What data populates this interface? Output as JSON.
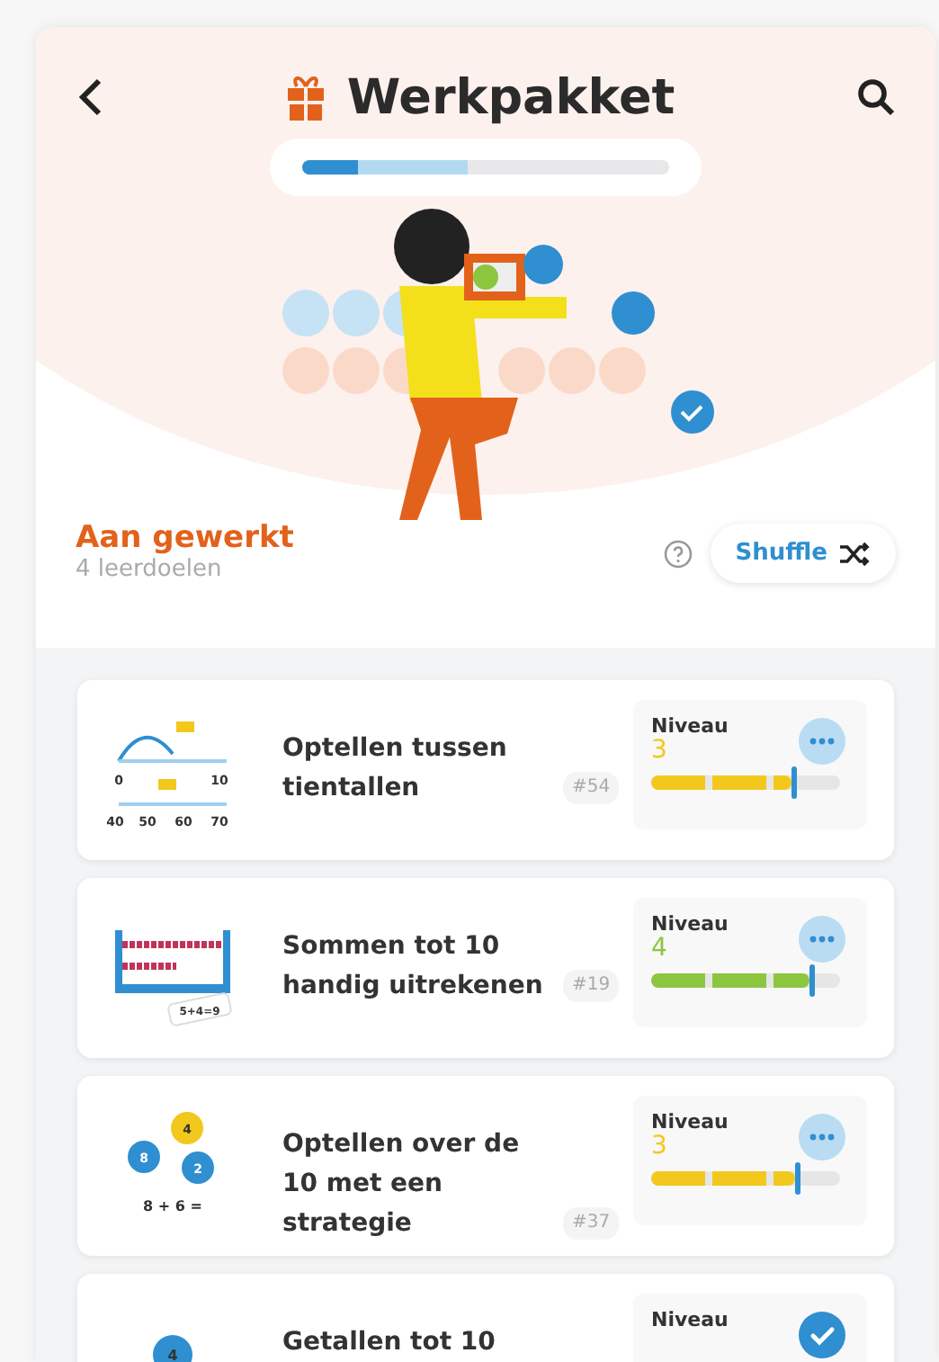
{
  "header": {
    "title": "Werkpakket",
    "progress": {
      "segments": [
        {
          "kind": "done",
          "level": 0.15
        },
        {
          "kind": "started",
          "level": 0.3
        }
      ]
    }
  },
  "section": {
    "title": "Aan gewerkt",
    "subtitle": "4 leerdoelen",
    "shuffle_button": "Shuffle"
  },
  "goals": [
    {
      "kind": "numberline",
      "title": "Optellen tussen tientallen",
      "tag": "#54",
      "level_label": "Niveau",
      "level_value": "3",
      "color": "#f2c81c",
      "level": 0.74,
      "completed": false,
      "illustration_labels": [
        "0",
        "10",
        "40",
        "50",
        "60",
        "70"
      ]
    },
    {
      "kind": "abacus",
      "title": "Sommen tot 10 handig uitrekenen",
      "tag": "#19",
      "level_label": "Niveau",
      "level_value": "4",
      "color": "#8cc63f",
      "level": 0.84,
      "completed": false,
      "illustration_labels": [
        "5+4=9"
      ]
    },
    {
      "kind": "bubbles",
      "title": "Optellen over de 10 met een strategie",
      "tag": "#37",
      "level_label": "Niveau",
      "level_value": "3",
      "color": "#f2c81c",
      "level": 0.76,
      "completed": false,
      "illustration_labels": [
        "4",
        "8",
        "2",
        "8 + 6 ="
      ]
    },
    {
      "kind": "single",
      "title": "Getallen tot 10",
      "level_label": "Niveau",
      "completed": true,
      "illustration_labels": [
        "4"
      ]
    }
  ]
}
